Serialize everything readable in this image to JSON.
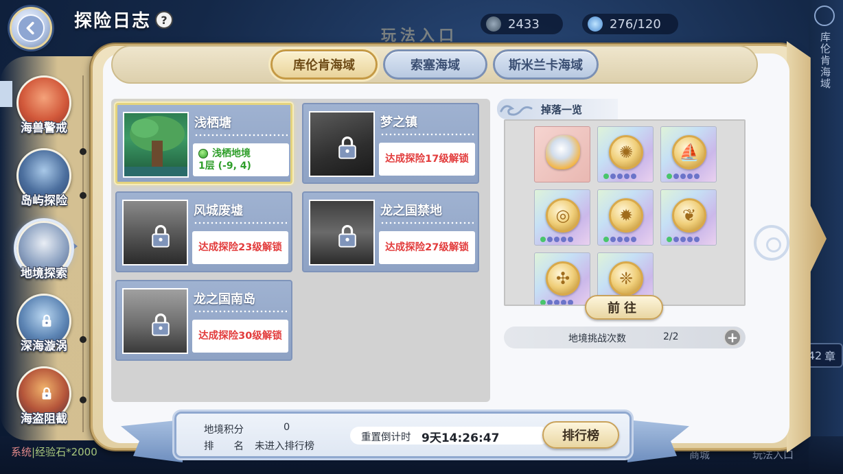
{
  "header": {
    "title": "探险日志",
    "help_label": "?",
    "resource_gold": "2433",
    "resource_energy": "276/120",
    "background_banner": "玩法入口"
  },
  "right_rail": {
    "vertical_label": "库伦肯海域",
    "chapter_number": "42",
    "chapter_suffix": "章"
  },
  "tabs": [
    {
      "label": "库伦肯海域",
      "active": true
    },
    {
      "label": "索塞海域",
      "active": false
    },
    {
      "label": "斯米兰卡海域",
      "active": false
    }
  ],
  "sidebar": {
    "items": [
      {
        "label": "海兽警戒",
        "icon": "sea-beast-icon",
        "active": false,
        "locked": false
      },
      {
        "label": "岛屿探险",
        "icon": "island-icon",
        "active": false,
        "locked": false
      },
      {
        "label": "地境探索",
        "icon": "skull-terrain-icon",
        "active": true,
        "locked": false
      },
      {
        "label": "深海漩涡",
        "icon": "whirlpool-icon",
        "active": false,
        "locked": true
      },
      {
        "label": "海盗阻截",
        "icon": "pirate-icon",
        "active": false,
        "locked": true
      }
    ]
  },
  "maps": [
    {
      "name": "浅栖塘",
      "status": "current",
      "area_name": "浅栖地境",
      "position": "1层 (-9, 4)",
      "locked": false
    },
    {
      "name": "梦之镇",
      "status": "locked",
      "unlock_text": "达成探险17级解锁",
      "locked": true
    },
    {
      "name": "风城废墟",
      "status": "locked",
      "unlock_text": "达成探险23级解锁",
      "locked": true
    },
    {
      "name": "龙之国禁地",
      "status": "locked",
      "unlock_text": "达成探险27级解锁",
      "locked": true
    },
    {
      "name": "龙之国南岛",
      "status": "locked",
      "unlock_text": "达成探险30级解锁",
      "locked": true
    }
  ],
  "drops": {
    "title": "掉落一览",
    "items": [
      {
        "icon": "golden-orb-icon",
        "symbol": "",
        "pips": 0
      },
      {
        "icon": "sun-coin-icon",
        "symbol": "✺",
        "pips": 5
      },
      {
        "icon": "ship-coin-icon",
        "symbol": "⛵",
        "pips": 5
      },
      {
        "icon": "swirl-coin-icon",
        "symbol": "◎",
        "pips": 5
      },
      {
        "icon": "beast-coin-icon",
        "symbol": "✹",
        "pips": 5
      },
      {
        "icon": "crest-coin-icon",
        "symbol": "❦",
        "pips": 5
      },
      {
        "icon": "cross-coin-icon",
        "symbol": "✣",
        "pips": 5
      },
      {
        "icon": "rune-coin-icon",
        "symbol": "❈",
        "pips": 5
      }
    ],
    "goto_label": "前往"
  },
  "challenge": {
    "label": "地境挑战次数",
    "value": "2/2",
    "plus_label": "+"
  },
  "score_banner": {
    "score_label": "地境积分",
    "score_value": "0",
    "rank_label": "排　　名",
    "rank_value": "未进入排行榜",
    "reset_label": "重置倒计时",
    "reset_value": "9天14:26:47",
    "leaderboard_label": "排行榜"
  },
  "footer": {
    "chat_prefix": "系统",
    "chat_text": "|经验石*2000",
    "tab_shop": "商城",
    "tab_entrance": "玩法入口"
  },
  "colors": {
    "lock_text": "#e23c3c",
    "current_text": "#2f9e2a",
    "tab_active_border": "#c59a45",
    "card_bg": "#8ea2c4"
  }
}
